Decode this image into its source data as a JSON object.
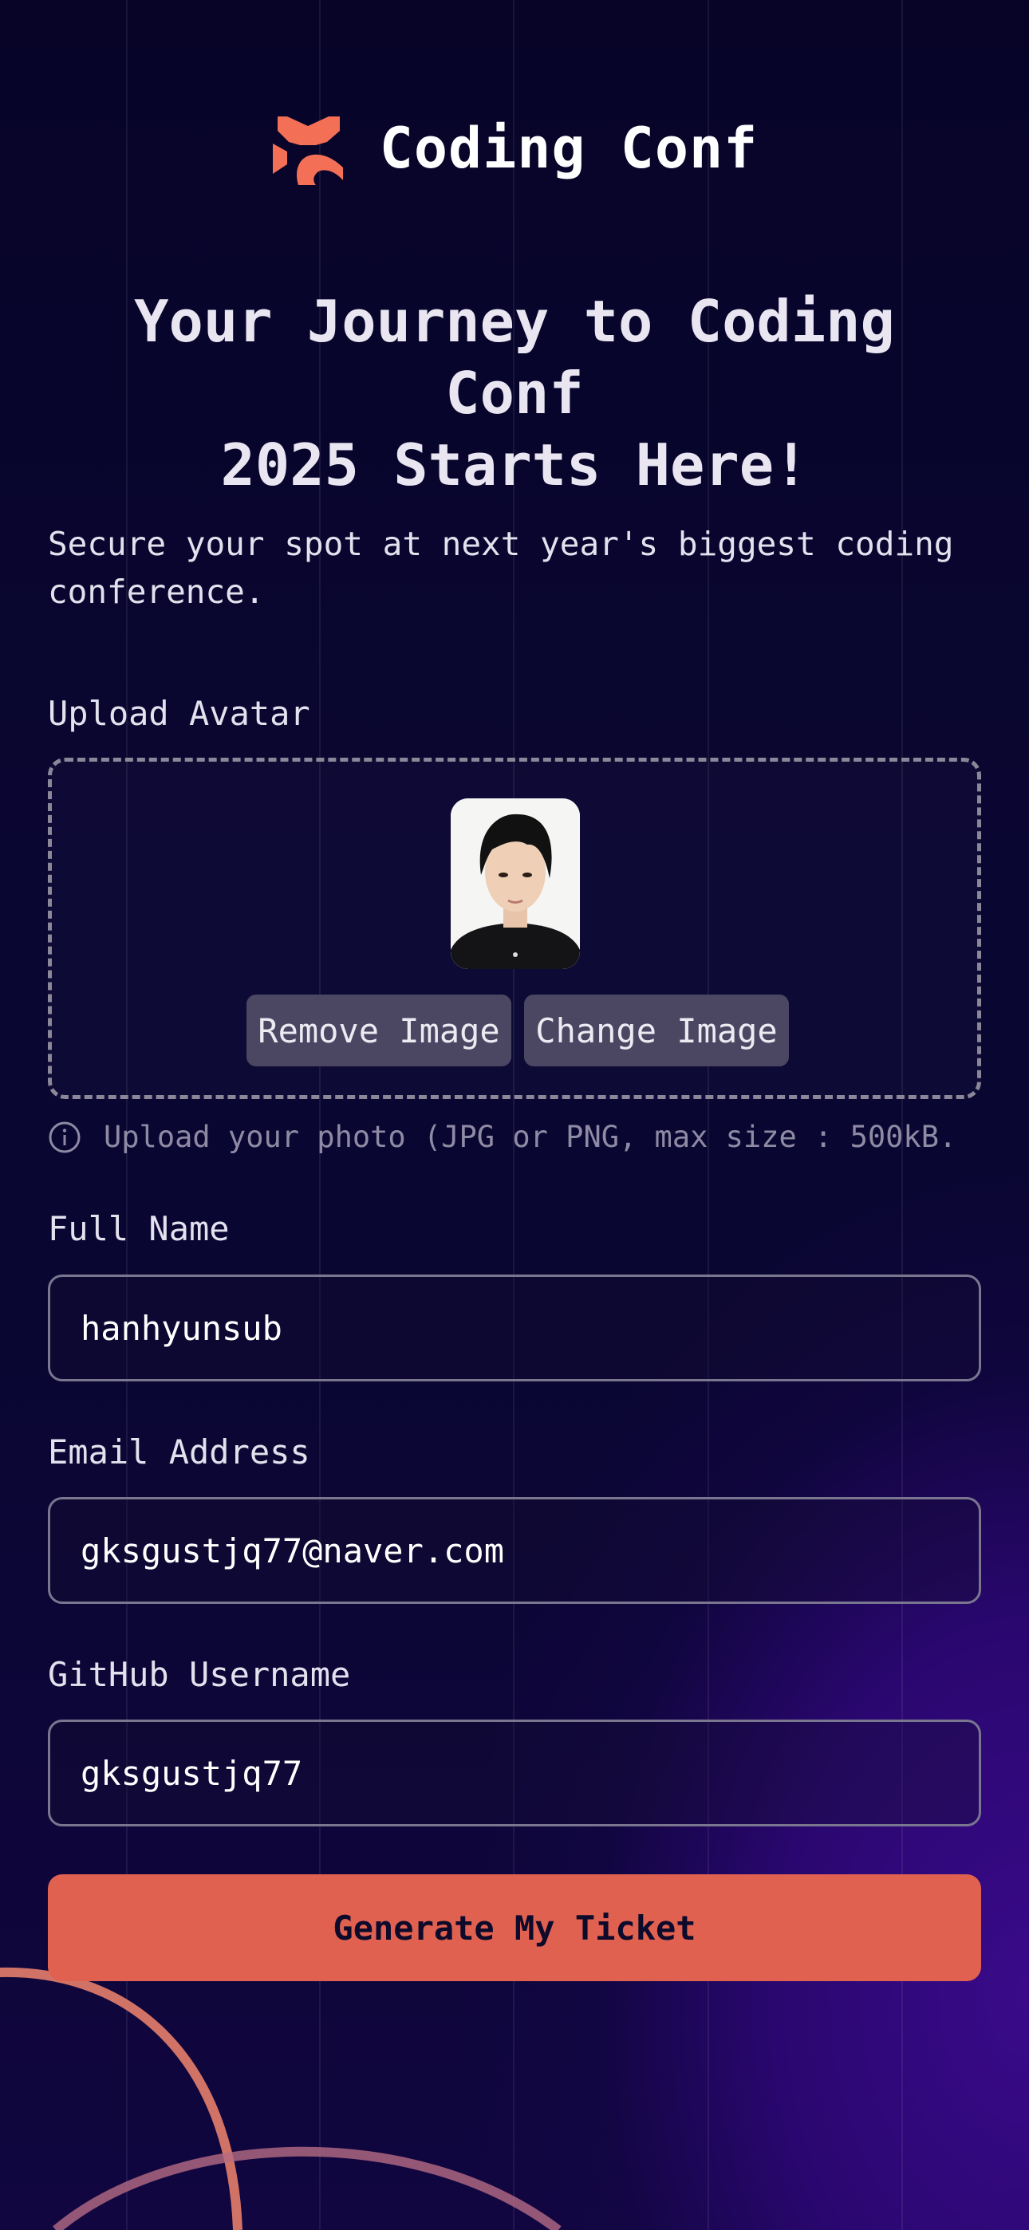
{
  "brand": {
    "name": "Coding Conf",
    "accent_color": "#e06150",
    "logo_icon": "coding-conf-logo-icon"
  },
  "hero": {
    "headline_line1": "Your Journey to Coding Conf",
    "headline_line2": "2025 Starts Here!",
    "subline": "Secure your spot at next year's biggest coding conference."
  },
  "upload": {
    "label": "Upload Avatar",
    "remove_label": "Remove Image",
    "change_label": "Change Image",
    "hint": "Upload your photo (JPG or PNG, max size : 500kB.",
    "hint_icon": "info-icon"
  },
  "form": {
    "full_name_label": "Full Name",
    "full_name_value": "hanhyunsub",
    "email_label": "Email Address",
    "email_value": "gksgustjq77@naver.com",
    "github_label": "GitHub Username",
    "github_value": "gksgustjq77",
    "submit_label": "Generate My Ticket"
  }
}
